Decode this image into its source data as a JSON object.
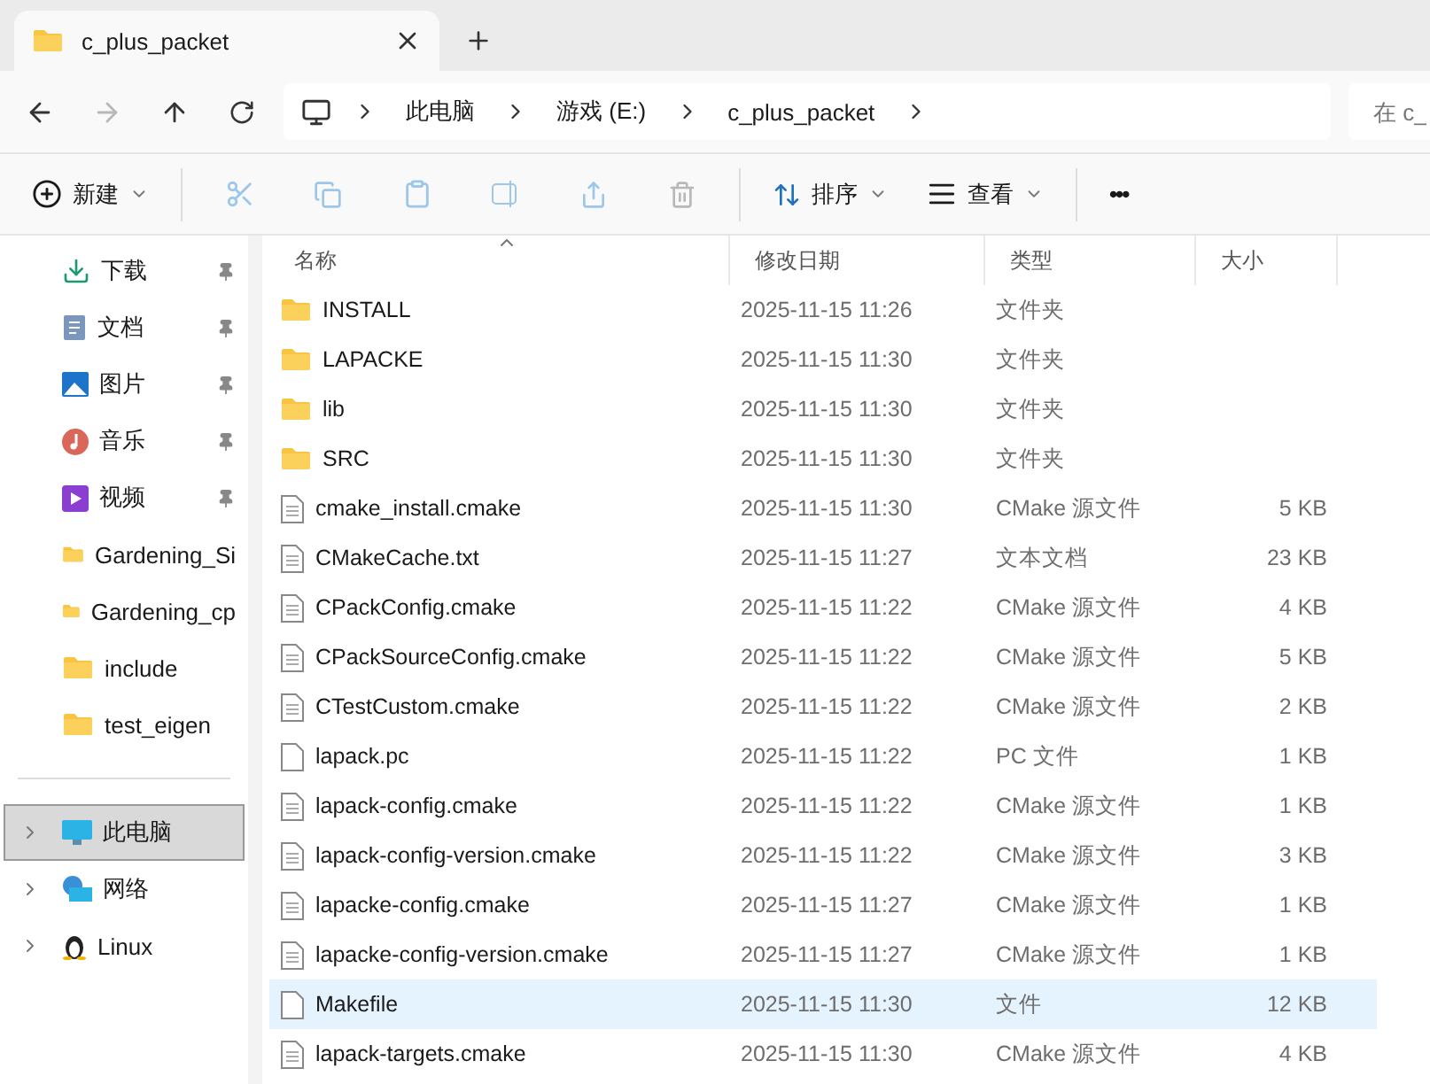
{
  "tab": {
    "title": "c_plus_packet"
  },
  "breadcrumb": [
    "此电脑",
    "游戏 (E:)",
    "c_plus_packet"
  ],
  "search": {
    "placeholder": "在 c_"
  },
  "toolbar": {
    "new": "新建",
    "sort": "排序",
    "view": "查看",
    "more": "•••"
  },
  "sidebar": {
    "quick": [
      {
        "label": "下载",
        "kind": "download",
        "pinned": true
      },
      {
        "label": "文档",
        "kind": "docs",
        "pinned": true
      },
      {
        "label": "图片",
        "kind": "pictures",
        "pinned": true
      },
      {
        "label": "音乐",
        "kind": "music",
        "pinned": true
      },
      {
        "label": "视频",
        "kind": "video",
        "pinned": true
      },
      {
        "label": "Gardening_Si",
        "kind": "folder",
        "pinned": false
      },
      {
        "label": "Gardening_cp",
        "kind": "folder",
        "pinned": false
      },
      {
        "label": "include",
        "kind": "folder",
        "pinned": false
      },
      {
        "label": "test_eigen",
        "kind": "folder",
        "pinned": false
      }
    ],
    "places": [
      {
        "label": "此电脑",
        "kind": "pc",
        "selected": true
      },
      {
        "label": "网络",
        "kind": "network",
        "selected": false
      },
      {
        "label": "Linux",
        "kind": "linux",
        "selected": false
      }
    ]
  },
  "table": {
    "columns": [
      "名称",
      "修改日期",
      "类型",
      "大小"
    ],
    "rows": [
      {
        "name": "INSTALL",
        "kind": "folder",
        "date": "2025-11-15 11:26",
        "type": "文件夹",
        "selected": false
      },
      {
        "name": "LAPACKE",
        "kind": "folder",
        "date": "2025-11-15 11:30",
        "type": "文件夹",
        "selected": false
      },
      {
        "name": "lib",
        "kind": "folder",
        "date": "2025-11-15 11:30",
        "type": "文件夹",
        "selected": false
      },
      {
        "name": "SRC",
        "kind": "folder",
        "date": "2025-11-15 11:30",
        "type": "文件夹",
        "selected": false
      },
      {
        "name": "cmake_install.cmake",
        "kind": "text",
        "date": "2025-11-15 11:30",
        "type": "CMake 源文件",
        "size": "5 KB",
        "selected": false
      },
      {
        "name": "CMakeCache.txt",
        "kind": "text",
        "date": "2025-11-15 11:27",
        "type": "文本文档",
        "size": "23 KB",
        "selected": false
      },
      {
        "name": "CPackConfig.cmake",
        "kind": "text",
        "date": "2025-11-15 11:22",
        "type": "CMake 源文件",
        "size": "4 KB",
        "selected": false
      },
      {
        "name": "CPackSourceConfig.cmake",
        "kind": "text",
        "date": "2025-11-15 11:22",
        "type": "CMake 源文件",
        "size": "5 KB",
        "selected": false
      },
      {
        "name": "CTestCustom.cmake",
        "kind": "text",
        "date": "2025-11-15 11:22",
        "type": "CMake 源文件",
        "size": "2 KB",
        "selected": false
      },
      {
        "name": "lapack.pc",
        "kind": "blank",
        "date": "2025-11-15 11:22",
        "type": "PC 文件",
        "size": "1 KB",
        "selected": false
      },
      {
        "name": "lapack-config.cmake",
        "kind": "text",
        "date": "2025-11-15 11:22",
        "type": "CMake 源文件",
        "size": "1 KB",
        "selected": false
      },
      {
        "name": "lapack-config-version.cmake",
        "kind": "text",
        "date": "2025-11-15 11:22",
        "type": "CMake 源文件",
        "size": "3 KB",
        "selected": false
      },
      {
        "name": "lapacke-config.cmake",
        "kind": "text",
        "date": "2025-11-15 11:27",
        "type": "CMake 源文件",
        "size": "1 KB",
        "selected": false
      },
      {
        "name": "lapacke-config-version.cmake",
        "kind": "text",
        "date": "2025-11-15 11:27",
        "type": "CMake 源文件",
        "size": "1 KB",
        "selected": false
      },
      {
        "name": "Makefile",
        "kind": "blank",
        "date": "2025-11-15 11:30",
        "type": "文件",
        "size": "12 KB",
        "selected": true
      },
      {
        "name": "lapack-targets.cmake",
        "kind": "text",
        "date": "2025-11-15 11:30",
        "type": "CMake 源文件",
        "size": "4 KB",
        "selected": false
      }
    ]
  }
}
